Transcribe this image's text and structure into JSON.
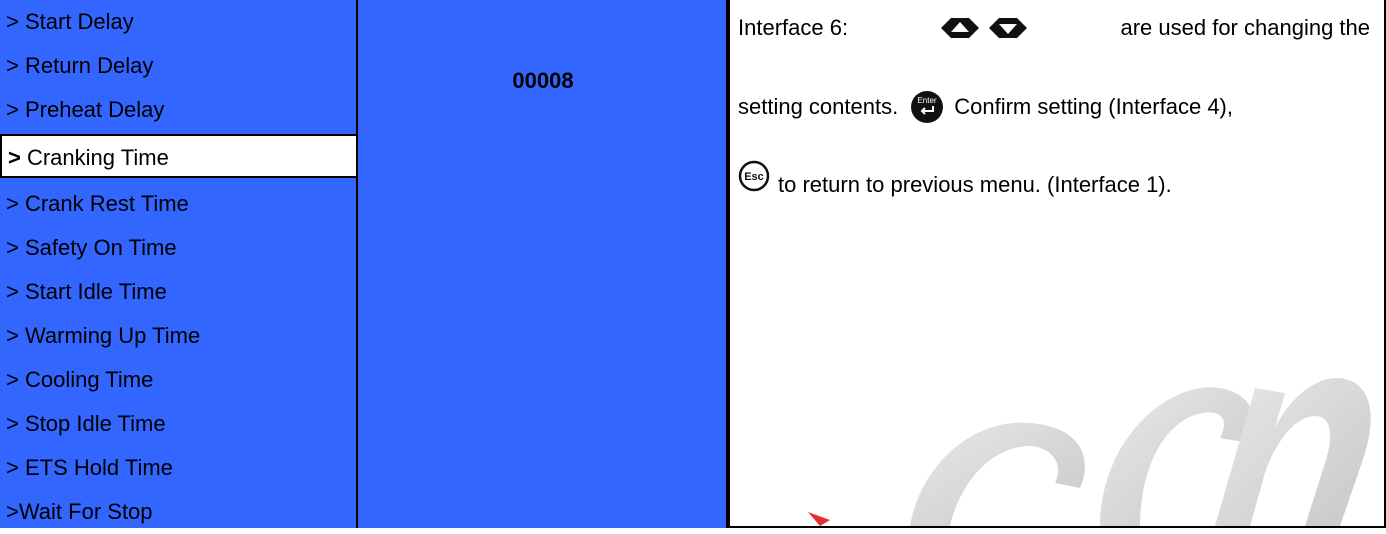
{
  "menu": {
    "items": [
      {
        "arrow": ">",
        "label": " Start Delay"
      },
      {
        "arrow": ">",
        "label": " Return Delay"
      },
      {
        "arrow": ">",
        "label": " Preheat Delay"
      },
      {
        "arrow": ">",
        "label": " Cranking Time"
      },
      {
        "arrow": ">",
        "label": " Crank Rest Time"
      },
      {
        "arrow": ">",
        "label": " Safety On Time"
      },
      {
        "arrow": ">",
        "label": " Start Idle Time"
      },
      {
        "arrow": ">",
        "label": " Warming Up Time"
      },
      {
        "arrow": ">",
        "label": " Cooling Time"
      },
      {
        "arrow": ">",
        "label": " Stop Idle Time"
      },
      {
        "arrow": ">",
        "label": " ETS Hold Time"
      },
      {
        "arrow": ">",
        "label": "Wait For Stop"
      }
    ],
    "selected_index": 3
  },
  "value": {
    "text": "00008"
  },
  "description": {
    "line1_prefix": "Interface 6:",
    "line1_suffix": "are used for changing the",
    "line2_prefix": "setting contents.",
    "line2_suffix": "Confirm setting (Interface 4),",
    "line3_suffix": "to return to previous menu. (Interface 1).",
    "enter_key_label": "Enter",
    "esc_key_label": "Esc"
  },
  "watermark": {
    "text": "Gen"
  },
  "colors": {
    "panel_blue": "#3366ff",
    "selected_bg": "#ffffff",
    "icon_dark": "#111111",
    "watermark_gray": "#cfcfcf",
    "watermark_red": "#e03030"
  },
  "icons": {
    "up_key": "up-triangle-key-icon",
    "down_key": "down-triangle-key-icon",
    "enter_key": "enter-key-icon",
    "esc_key": "esc-key-icon"
  }
}
